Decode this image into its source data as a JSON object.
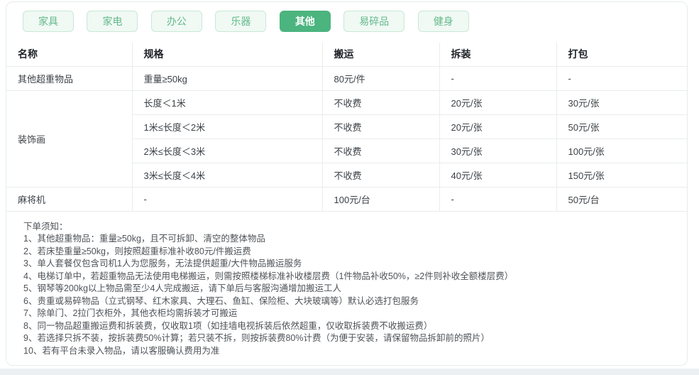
{
  "colors": {
    "accent_green": "#4bb47f",
    "tab_bg": "#f0f9f4",
    "tab_border": "#c9e8d7",
    "tab_text": "#63b98a",
    "table_border": "#e9edec"
  },
  "tabs": [
    {
      "label": "家具",
      "active": false
    },
    {
      "label": "家电",
      "active": false
    },
    {
      "label": "办公",
      "active": false
    },
    {
      "label": "乐器",
      "active": false
    },
    {
      "label": "其他",
      "active": true
    },
    {
      "label": "易碎品",
      "active": false
    },
    {
      "label": "健身",
      "active": false
    }
  ],
  "table": {
    "headers": [
      "名称",
      "规格",
      "搬运",
      "拆装",
      "打包"
    ],
    "rows": [
      {
        "name": "其他超重物品",
        "cells": [
          "重量≥50kg",
          "80元/件",
          "-",
          "-"
        ]
      },
      {
        "name": "装饰画",
        "sub": [
          [
            "长度＜1米",
            "不收费",
            "20元/张",
            "30元/张"
          ],
          [
            "1米≤长度＜2米",
            "不收费",
            "20元/张",
            "50元/张"
          ],
          [
            "2米≤长度＜3米",
            "不收费",
            "30元/张",
            "100元/张"
          ],
          [
            "3米≤长度＜4米",
            "不收费",
            "40元/张",
            "150元/张"
          ]
        ]
      },
      {
        "name": "麻将机",
        "cells": [
          "-",
          "100元/台",
          "-",
          "50元/台"
        ]
      }
    ]
  },
  "notes": {
    "title": "下单须知：",
    "items": [
      "1、其他超重物品：重量≥50kg，且不可拆卸、清空的整体物品",
      "2、若床垫重量≥50kg，则按照超重标准补收80元/件搬运费",
      "3、单人套餐仅包含司机1人为您服务，无法提供超重/大件物品搬运服务",
      "4、电梯订单中，若超重物品无法使用电梯搬运，则需按照楼梯标准补收楼层费（1件物品补收50%，≥2件则补收全额楼层费）",
      "5、钢琴等200kg以上物品需至少4人完成搬运，请下单后与客服沟通增加搬运工人",
      "6、贵重或易碎物品（立式钢琴、红木家具、大理石、鱼缸、保险柜、大块玻璃等）默认必选打包服务",
      "7、除单门、2拉门衣柜外，其他衣柜均需拆装才可搬运",
      "8、同一物品超重搬运费和拆装费，仅收取1项（如挂墙电视拆装后依然超重，仅收取拆装费不收搬运费）",
      "9、若选择只拆不装，按拆装费50%计算；若只装不拆，则按拆装费80%计费（为便于安装，请保留物品拆卸前的照片）",
      "10、若有平台未录入物品，请以客服确认费用为准"
    ]
  }
}
